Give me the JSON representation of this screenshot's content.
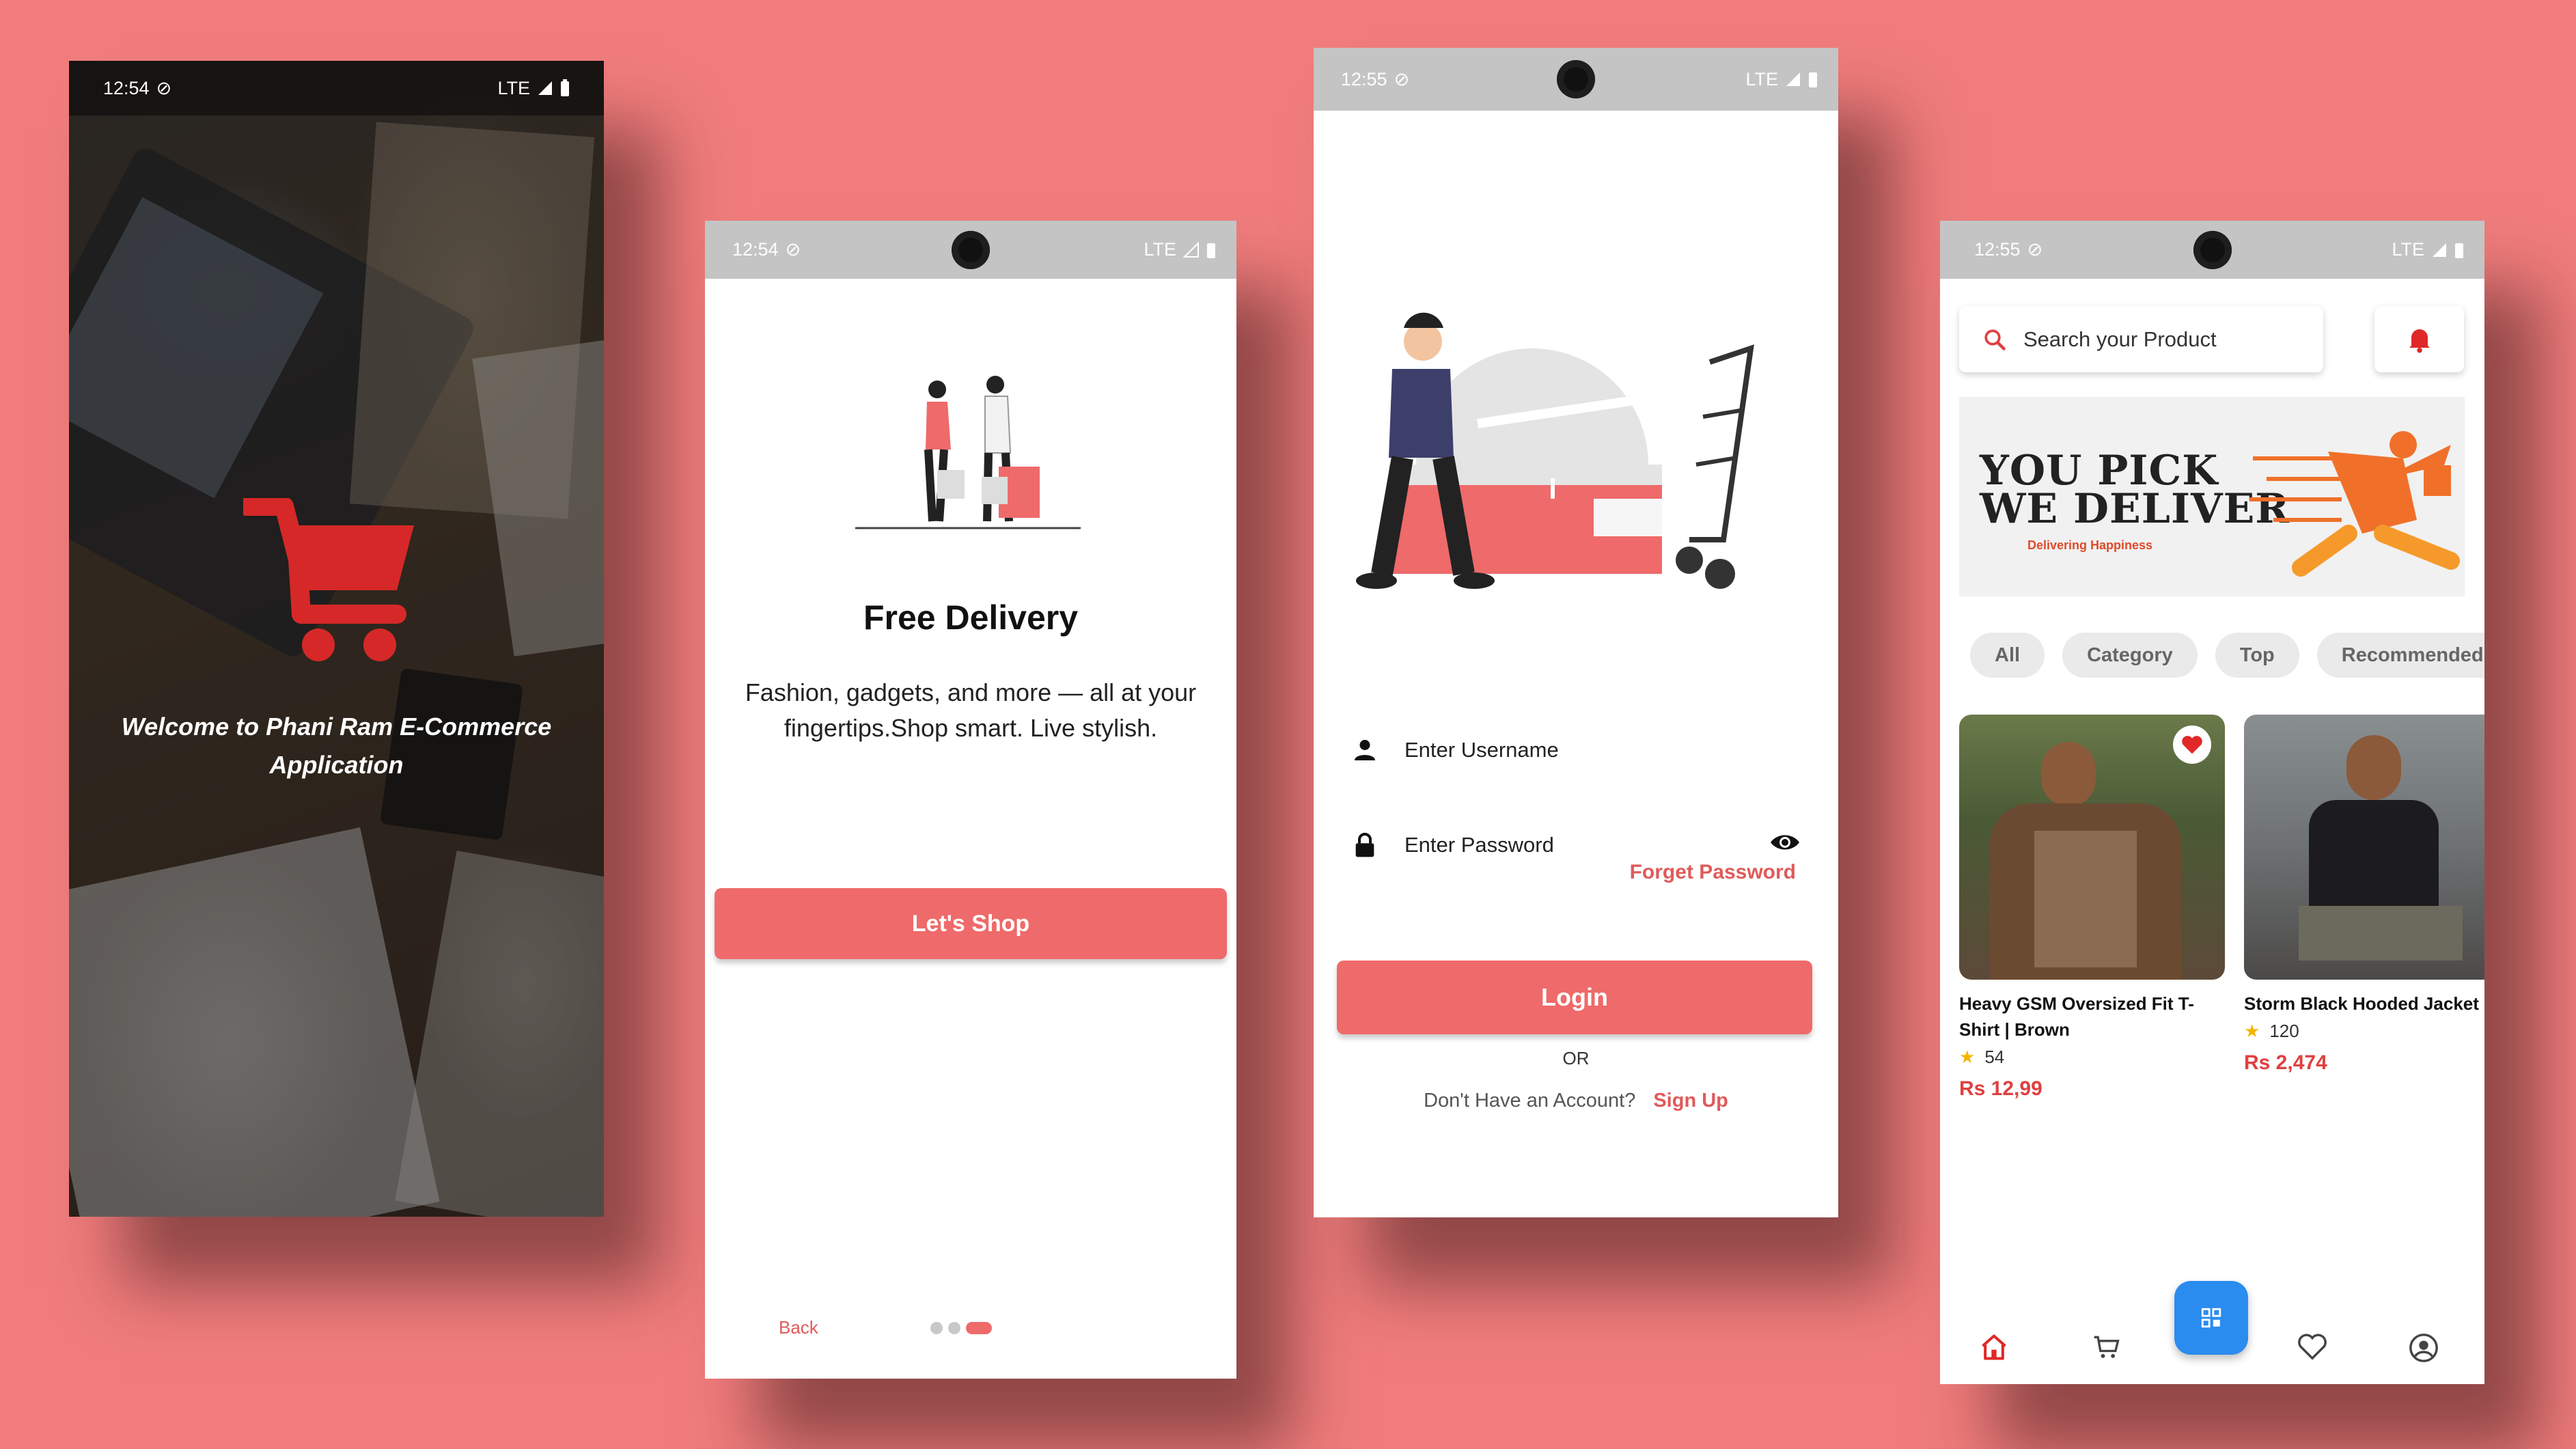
{
  "colors": {
    "background": "#f07c7c",
    "accent": "#ef6a6a",
    "statusbar": "#c4c4c4",
    "fab": "#2b8cf0"
  },
  "splash": {
    "status": {
      "time": "12:54",
      "network": "LTE"
    },
    "welcome": "Welcome to Phani Ram E-Commerce Application",
    "logo_icon": "shopping-cart-icon"
  },
  "onboarding": {
    "status": {
      "time": "12:54",
      "network": "LTE"
    },
    "title": "Free Delivery",
    "description": "Fashion, gadgets, and more — all at your fingertips.Shop smart. Live stylish.",
    "button": "Let's Shop",
    "back": "Back",
    "page_index": 3,
    "page_count": 3
  },
  "login": {
    "status": {
      "time": "12:55",
      "network": "LTE"
    },
    "username_placeholder": "Enter Username",
    "password_placeholder": "Enter Password",
    "forget": "Forget Password",
    "button": "Login",
    "or": "OR",
    "no_account": "Don't Have an Account?",
    "signup": "Sign Up"
  },
  "home": {
    "status": {
      "time": "12:55",
      "network": "LTE"
    },
    "search_placeholder": "Search your Product",
    "banner": {
      "line1": "YOU PICK",
      "line2": "WE DELIVER",
      "tagline": "Delivering Happiness"
    },
    "chips": [
      "All",
      "Category",
      "Top",
      "Recommended"
    ],
    "products": [
      {
        "name_line1": "Heavy GSM Oversized Fit T-",
        "name_line2": "Shirt | Brown",
        "rating": "54",
        "price": "Rs 12,99",
        "favorite": true
      },
      {
        "name_line1": "Storm Black Hooded Jacket",
        "name_line2": "",
        "rating": "120",
        "price": "Rs 2,474",
        "favorite": false
      }
    ],
    "nav": [
      "home-icon",
      "cart-icon",
      "heart-icon",
      "profile-icon"
    ]
  }
}
